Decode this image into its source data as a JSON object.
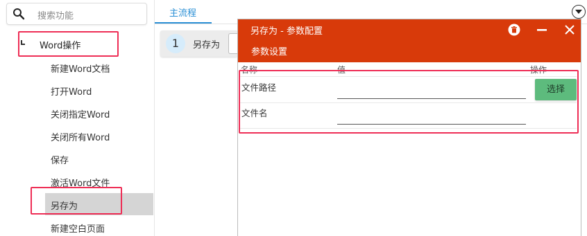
{
  "sidebar": {
    "search_placeholder": "搜索功能",
    "group_label": "Word操作",
    "items": [
      {
        "label": "新建Word文档"
      },
      {
        "label": "打开Word"
      },
      {
        "label": "关闭指定Word"
      },
      {
        "label": "关闭所有Word"
      },
      {
        "label": "保存"
      },
      {
        "label": "激活Word文件"
      },
      {
        "label": "另存为"
      },
      {
        "label": "新建空白页面"
      }
    ],
    "selected_item": "另存为"
  },
  "tabs": [
    {
      "label": "主流程",
      "active": true
    }
  ],
  "flow": {
    "steps": [
      {
        "number": "1",
        "label": "另存为"
      }
    ]
  },
  "dialog": {
    "title": "另存为 - 参数配置",
    "section_title": "参数设置",
    "columns": {
      "name": "名称",
      "value": "值",
      "action": "操作"
    },
    "params": [
      {
        "name": "文件路径",
        "value": "",
        "action_label": "选择"
      },
      {
        "name": "文件名",
        "value": ""
      }
    ],
    "header_icons": [
      "delete-icon",
      "minimize-icon",
      "close-icon"
    ]
  },
  "colors": {
    "dialog_header": "#d83a0a",
    "tab_active": "#2a8fd5",
    "select_button": "#5dbb7d",
    "highlight_box": "#ee2d55",
    "selected_row": "#d5d5d5"
  }
}
